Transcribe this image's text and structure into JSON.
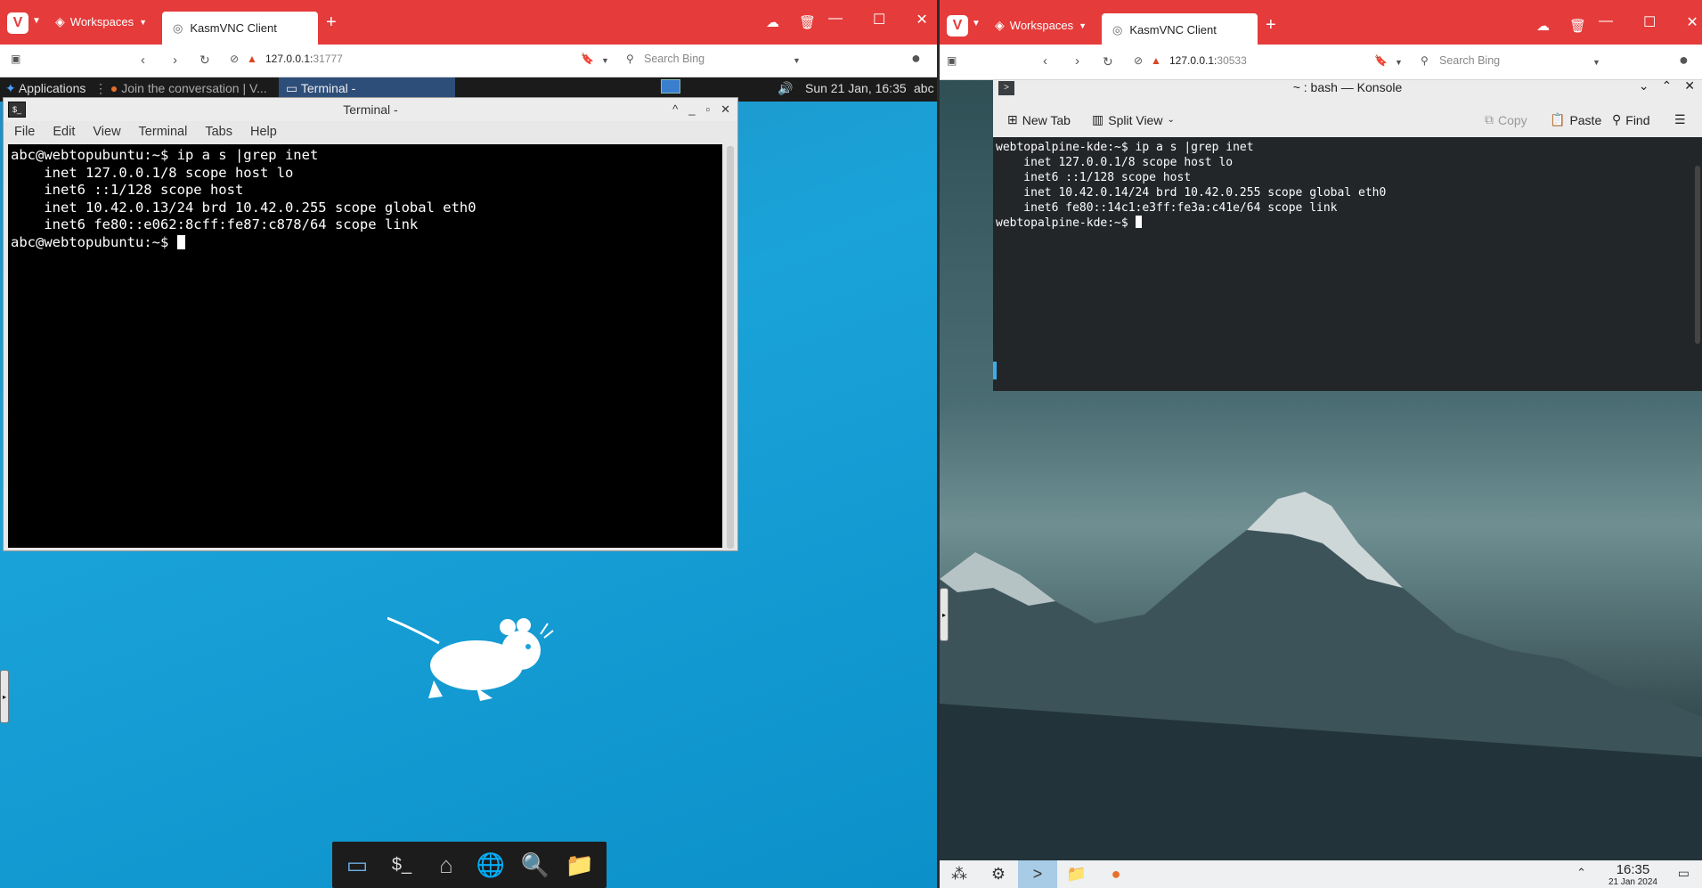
{
  "left_browser": {
    "workspaces_label": "Workspaces",
    "tab_title": "KasmVNC Client",
    "url_host": "127.0.0.1:",
    "url_port": "31777",
    "search_placeholder": "Search Bing"
  },
  "right_browser": {
    "workspaces_label": "Workspaces",
    "tab_title": "KasmVNC Client",
    "url_host": "127.0.0.1:",
    "url_port": "30533",
    "search_placeholder": "Search Bing"
  },
  "xfce": {
    "applications_label": "Applications",
    "task1_label": "Join the conversation | V...",
    "task2_label": "Terminal -",
    "clock": "Sun 21 Jan, 16:35",
    "user": "abc",
    "window_title": "Terminal -",
    "menu": [
      "File",
      "Edit",
      "View",
      "Terminal",
      "Tabs",
      "Help"
    ],
    "terminal_lines": [
      "abc@webtopubuntu:~$ ip a s |grep inet",
      "    inet 127.0.0.1/8 scope host lo",
      "    inet6 ::1/128 scope host",
      "    inet 10.42.0.13/24 brd 10.42.0.255 scope global eth0",
      "    inet6 fe80::e062:8cff:fe87:c878/64 scope link"
    ],
    "prompt": "abc@webtopubuntu:~$ "
  },
  "kde": {
    "window_title": "~ : bash — Konsole",
    "new_tab": "New Tab",
    "split_view": "Split View",
    "copy": "Copy",
    "paste": "Paste",
    "find": "Find",
    "terminal_lines": [
      "webtopalpine-kde:~$ ip a s |grep inet",
      "    inet 127.0.0.1/8 scope host lo",
      "    inet6 ::1/128 scope host",
      "    inet 10.42.0.14/24 brd 10.42.0.255 scope global eth0",
      "    inet6 fe80::14c1:e3ff:fe3a:c41e/64 scope link"
    ],
    "prompt": "webtopalpine-kde:~$ ",
    "clock_time": "16:35",
    "clock_date": "21 Jan 2024"
  },
  "colors": {
    "vivaldi_red": "#e53b3b",
    "xfce_blue": "#1aa3d9",
    "konsole_bg": "#232629"
  }
}
